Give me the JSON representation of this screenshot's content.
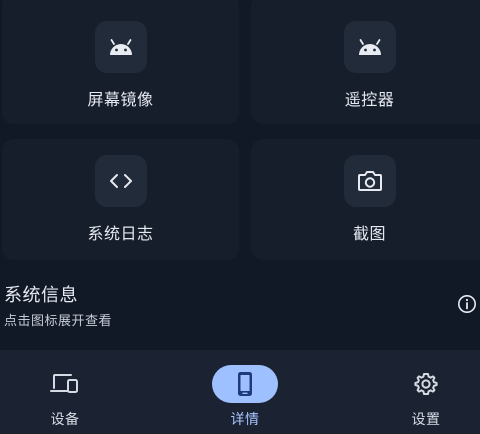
{
  "cards": [
    {
      "label": "屏幕镜像",
      "icon": "android-icon"
    },
    {
      "label": "遥控器",
      "icon": "android-icon"
    },
    {
      "label": "系统日志",
      "icon": "code-icon"
    },
    {
      "label": "截图",
      "icon": "camera-icon"
    }
  ],
  "system_info": {
    "title": "系统信息",
    "subtitle": "点击图标展开查看",
    "icon": "info-icon"
  },
  "bottom_nav": {
    "items": [
      {
        "label": "设备",
        "icon": "devices-icon",
        "active": false
      },
      {
        "label": "详情",
        "icon": "phone-icon",
        "active": true
      },
      {
        "label": "设置",
        "icon": "gear-icon",
        "active": false
      }
    ]
  },
  "colors": {
    "background": "#111826",
    "card": "#161e2c",
    "icon_box": "#222b3a",
    "nav_bar": "#1b2332",
    "accent": "#9fc0ff",
    "accent_icon": "#1f3a7a"
  }
}
